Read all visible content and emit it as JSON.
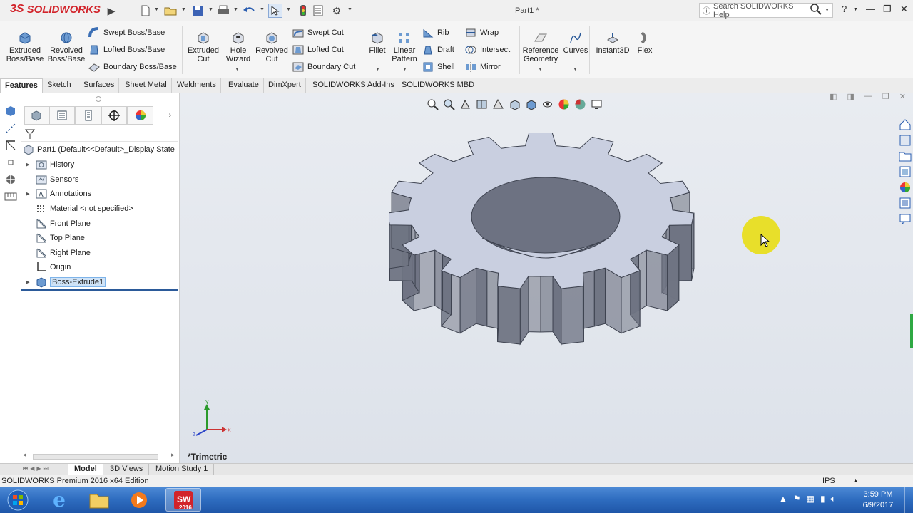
{
  "app": {
    "brand_prefix": "3S",
    "brand_name": "SOLIDWORKS",
    "doc_title": "Part1 *"
  },
  "search": {
    "placeholder": "Search SOLIDWORKS Help"
  },
  "command_manager": {
    "big_buttons": [
      {
        "label": "Extruded\nBoss/Base"
      },
      {
        "label": "Revolved\nBoss/Base"
      },
      {
        "label": "Extruded\nCut"
      },
      {
        "label": "Hole\nWizard"
      },
      {
        "label": "Revolved\nCut"
      },
      {
        "label": "Fillet"
      },
      {
        "label": "Linear\nPattern"
      },
      {
        "label": "Reference\nGeometry"
      },
      {
        "label": "Curves"
      },
      {
        "label": "Instant3D"
      },
      {
        "label": "Flex"
      }
    ],
    "small_buttons": {
      "swept_boss": "Swept Boss/Base",
      "lofted_boss": "Lofted Boss/Base",
      "boundary_boss": "Boundary Boss/Base",
      "swept_cut": "Swept Cut",
      "lofted_cut": "Lofted Cut",
      "boundary_cut": "Boundary Cut",
      "rib": "Rib",
      "draft": "Draft",
      "shell": "Shell",
      "wrap": "Wrap",
      "intersect": "Intersect",
      "mirror": "Mirror"
    },
    "tabs": [
      "Features",
      "Sketch",
      "Surfaces",
      "Sheet Metal",
      "Weldments",
      "Evaluate",
      "DimXpert",
      "SOLIDWORKS Add-Ins",
      "SOLIDWORKS MBD"
    ],
    "active_tab": "Features"
  },
  "feature_tree": {
    "root": "Part1  (Default<<Default>_Display State",
    "items": [
      {
        "label": "History",
        "icon": "history-folder-icon",
        "expandable": true
      },
      {
        "label": "Sensors",
        "icon": "sensors-icon",
        "expandable": false
      },
      {
        "label": "Annotations",
        "icon": "annotations-icon",
        "expandable": true
      },
      {
        "label": "Material <not specified>",
        "icon": "material-icon",
        "expandable": false
      },
      {
        "label": "Front Plane",
        "icon": "plane-icon",
        "expandable": false
      },
      {
        "label": "Top Plane",
        "icon": "plane-icon",
        "expandable": false
      },
      {
        "label": "Right Plane",
        "icon": "plane-icon",
        "expandable": false
      },
      {
        "label": "Origin",
        "icon": "origin-icon",
        "expandable": false
      },
      {
        "label": "Boss-Extrude1",
        "icon": "extrude-feature-icon",
        "expandable": true,
        "selected": true
      }
    ]
  },
  "viewport": {
    "view_name": "*Trimetric",
    "axis_labels": {
      "x": "X",
      "y": "Y",
      "z": "Z"
    }
  },
  "model_tabs": [
    "Model",
    "3D Views",
    "Motion Study 1"
  ],
  "active_model_tab": "Model",
  "status": {
    "edition": "SOLIDWORKS Premium 2016 x64 Edition",
    "units": "IPS"
  },
  "taskbar": {
    "time": "3:59 PM",
    "date": "6/9/2017",
    "sw_badge": "2016"
  },
  "colors": {
    "brand_red": "#d2232a",
    "gear_top": "#c9cfe0",
    "gear_side": "#6f7483",
    "cursor_highlight": "#e8de14",
    "taskbar": "#2e6cbf"
  }
}
